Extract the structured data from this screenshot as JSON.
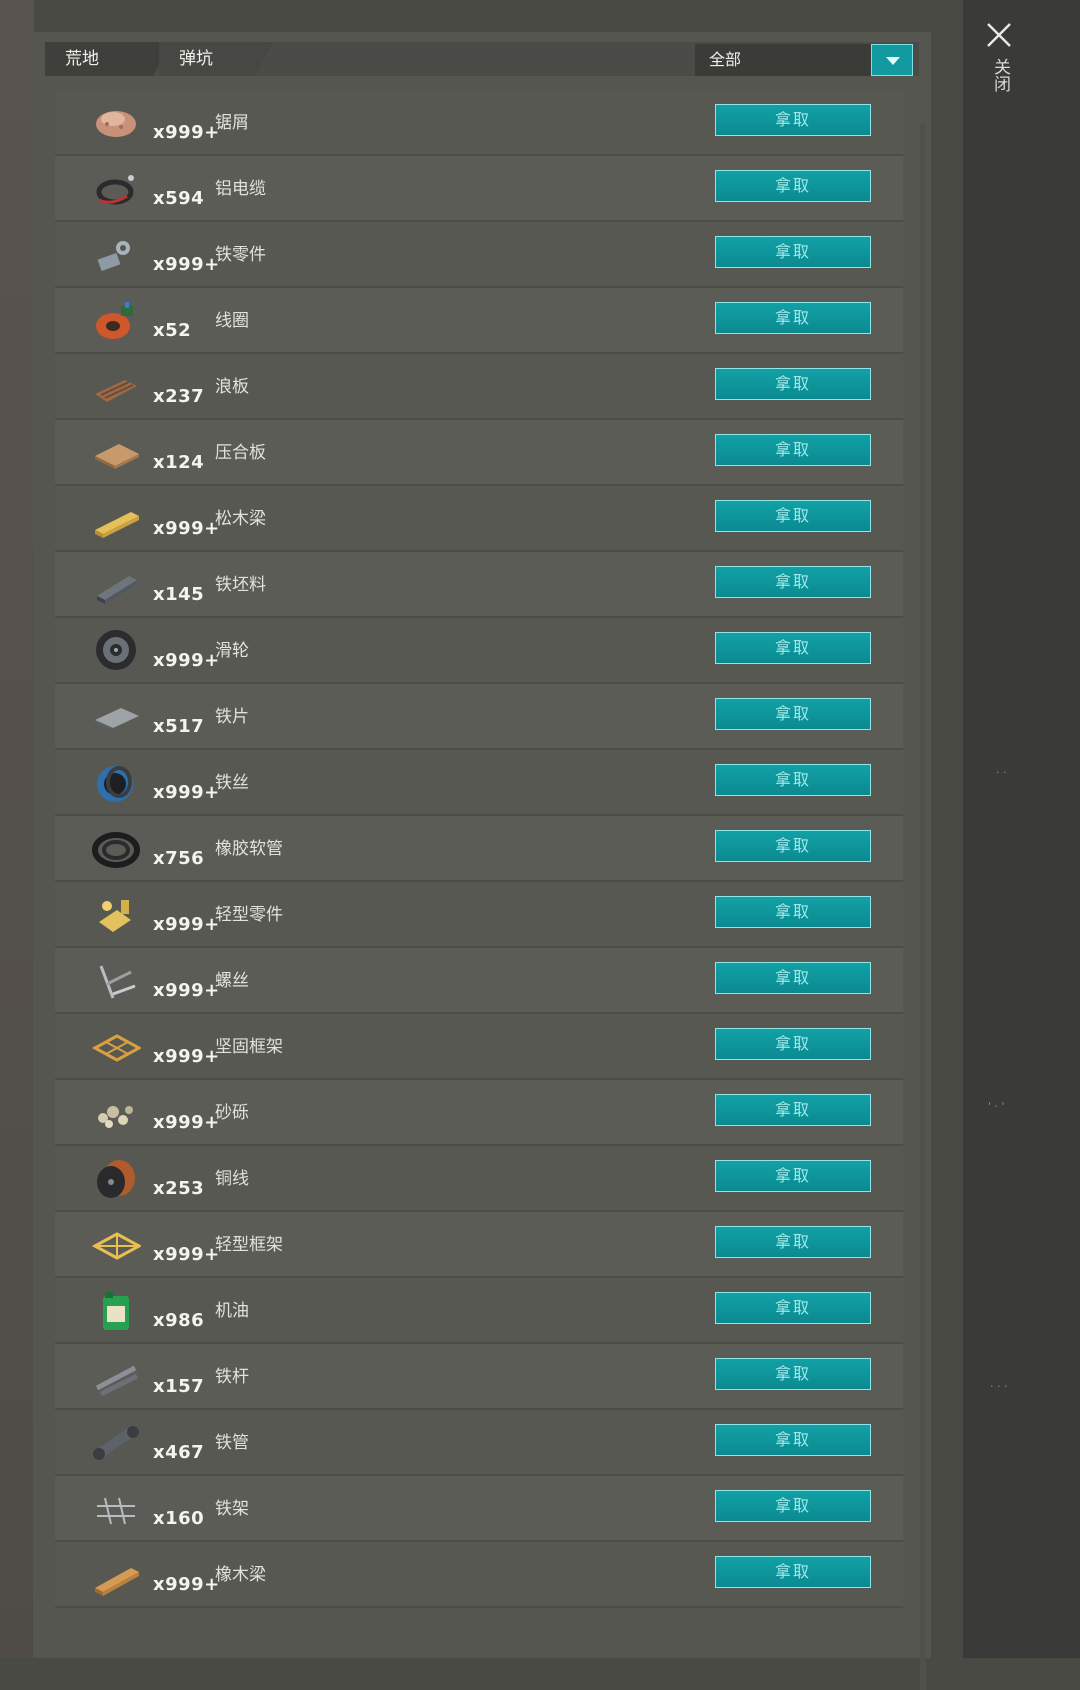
{
  "tabs": [
    {
      "label": "荒地"
    },
    {
      "label": "弹坑"
    }
  ],
  "filter": {
    "selected": "全部"
  },
  "close": {
    "label": "关闭"
  },
  "take_label": "拿取",
  "items": [
    {
      "qty": "x999+",
      "name": "锯屑",
      "icon": "sawdust-icon"
    },
    {
      "qty": "x594",
      "name": "铝电缆",
      "icon": "aluminum-cable-icon"
    },
    {
      "qty": "x999+",
      "name": "铁零件",
      "icon": "iron-parts-icon"
    },
    {
      "qty": "x52",
      "name": "线圈",
      "icon": "coil-icon"
    },
    {
      "qty": "x237",
      "name": "浪板",
      "icon": "corrugated-board-icon"
    },
    {
      "qty": "x124",
      "name": "压合板",
      "icon": "plywood-icon"
    },
    {
      "qty": "x999+",
      "name": "松木梁",
      "icon": "pine-beam-icon"
    },
    {
      "qty": "x145",
      "name": "铁坯料",
      "icon": "iron-billet-icon"
    },
    {
      "qty": "x999+",
      "name": "滑轮",
      "icon": "pulley-icon"
    },
    {
      "qty": "x517",
      "name": "铁片",
      "icon": "iron-sheet-icon"
    },
    {
      "qty": "x999+",
      "name": "铁丝",
      "icon": "wire-spool-icon"
    },
    {
      "qty": "x756",
      "name": "橡胶软管",
      "icon": "rubber-hose-icon"
    },
    {
      "qty": "x999+",
      "name": "轻型零件",
      "icon": "light-parts-icon"
    },
    {
      "qty": "x999+",
      "name": "螺丝",
      "icon": "screws-icon"
    },
    {
      "qty": "x999+",
      "name": "坚固框架",
      "icon": "sturdy-frame-icon"
    },
    {
      "qty": "x999+",
      "name": "砂砾",
      "icon": "gravel-icon"
    },
    {
      "qty": "x253",
      "name": "铜线",
      "icon": "copper-wire-icon"
    },
    {
      "qty": "x999+",
      "name": "轻型框架",
      "icon": "light-frame-icon"
    },
    {
      "qty": "x986",
      "name": "机油",
      "icon": "motor-oil-icon"
    },
    {
      "qty": "x157",
      "name": "铁杆",
      "icon": "iron-rods-icon"
    },
    {
      "qty": "x467",
      "name": "铁管",
      "icon": "iron-pipe-icon"
    },
    {
      "qty": "x160",
      "name": "铁架",
      "icon": "iron-rack-icon"
    },
    {
      "qty": "x999+",
      "name": "橡木梁",
      "icon": "oak-beam-icon"
    }
  ],
  "colors": {
    "accent": "#12a1a6",
    "accent_border": "#8fe6e8",
    "panel": "#565651"
  }
}
